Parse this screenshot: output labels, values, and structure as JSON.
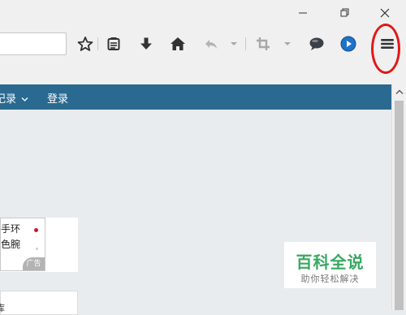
{
  "toolbar": {
    "icons": [
      "star-icon",
      "reading-list-icon",
      "download-icon",
      "home-icon",
      "back-icon",
      "dropdown-arrow-icon",
      "crop-icon",
      "dropdown-arrow-icon",
      "chat-bubble-icon",
      "video-play-icon",
      "menu-icon"
    ],
    "highlight_color": "#e01818"
  },
  "site_nav": {
    "item_1": "记录",
    "login": "登录",
    "background": "#2a6a90"
  },
  "ad": {
    "line_1": "手环",
    "line_2": "色腕",
    "badge": "广告"
  },
  "bottom_panel": {
    "text": "库"
  },
  "watermark": {
    "title": "百科全说",
    "subtitle": "助你轻松解决",
    "color": "#38a860"
  }
}
